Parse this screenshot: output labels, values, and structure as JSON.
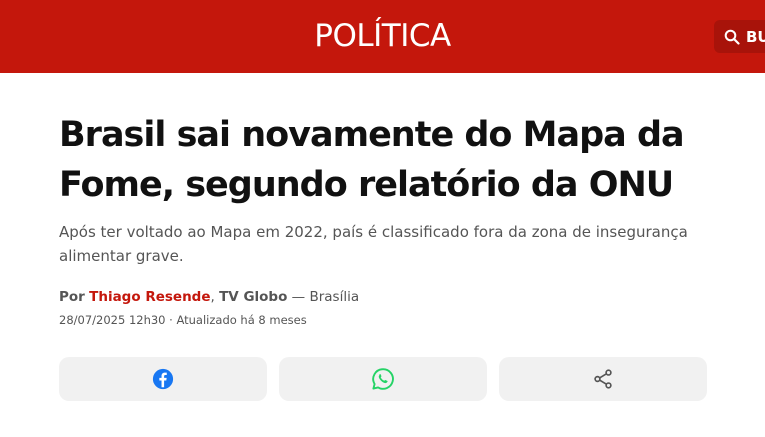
{
  "header": {
    "section_title": "POLÍTICA",
    "search_label": "BU",
    "background_color": "#c4170c"
  },
  "article": {
    "headline": "Brasil sai novamente do Mapa da Fome, segundo relatório da ONU",
    "subtitle": "Após ter voltado ao Mapa em 2022, país é classificado fora da zona de insegurança alimentar grave.",
    "byline": {
      "prefix": "Por",
      "author": "Thiago Resende",
      "separator": ",",
      "outlet": "TV Globo",
      "dash": "—",
      "location": "Brasília"
    },
    "dateline": "28/07/2025 12h30 · Atualizado há 8 meses"
  },
  "share": {
    "buttons": [
      {
        "icon": "facebook-icon",
        "color": "#1877f2"
      },
      {
        "icon": "whatsapp-icon",
        "color": "#25d366"
      },
      {
        "icon": "share-icon",
        "color": "#555555"
      }
    ]
  }
}
